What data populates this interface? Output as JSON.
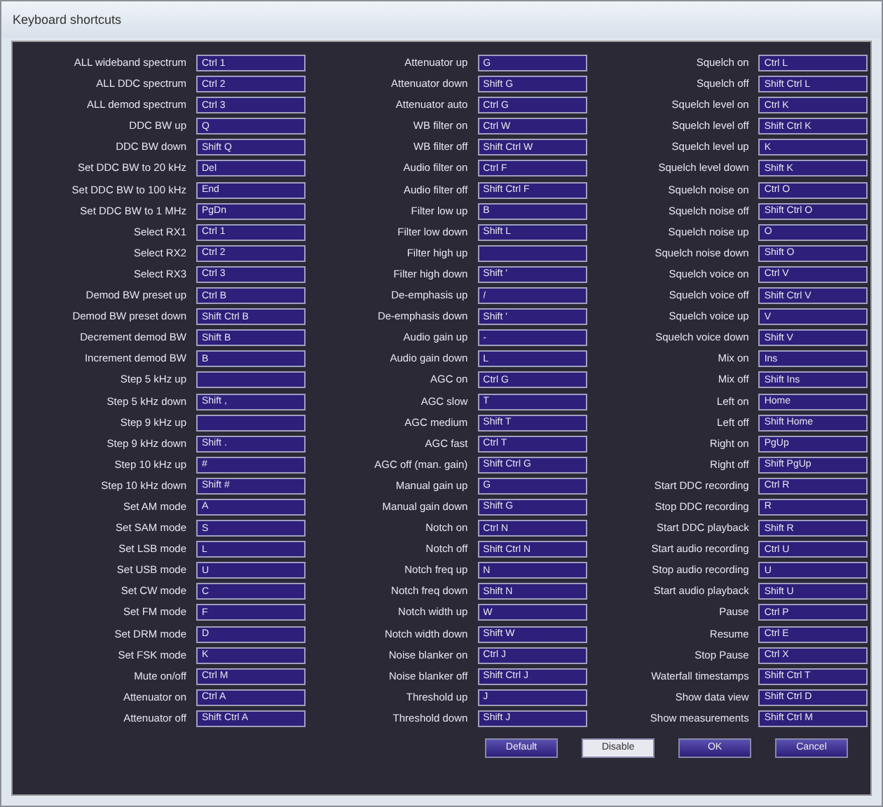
{
  "window": {
    "title": "Keyboard shortcuts"
  },
  "columns": [
    {
      "shortcuts": [
        {
          "label": "ALL wideband spectrum",
          "key": "Ctrl 1"
        },
        {
          "label": "ALL DDC spectrum",
          "key": "Ctrl 2"
        },
        {
          "label": "ALL demod spectrum",
          "key": "Ctrl 3"
        },
        {
          "label": "DDC BW up",
          "key": "Q"
        },
        {
          "label": "DDC BW down",
          "key": "Shift Q"
        },
        {
          "label": "Set DDC BW to 20 kHz",
          "key": "Del"
        },
        {
          "label": "Set DDC BW to 100 kHz",
          "key": "End"
        },
        {
          "label": "Set DDC BW to 1 MHz",
          "key": "PgDn"
        },
        {
          "label": "Select RX1",
          "key": "Ctrl 1"
        },
        {
          "label": "Select RX2",
          "key": "Ctrl 2"
        },
        {
          "label": "Select RX3",
          "key": "Ctrl 3"
        },
        {
          "label": "Demod BW preset up",
          "key": "Ctrl B"
        },
        {
          "label": "Demod BW preset down",
          "key": "Shift Ctrl B"
        },
        {
          "label": "Decrement demod BW",
          "key": "Shift B"
        },
        {
          "label": "Increment demod BW",
          "key": "B"
        },
        {
          "label": "Step 5 kHz up"
        },
        {
          "label": "Step 5 kHz down",
          "key": "Shift ,"
        },
        {
          "label": "Step 9 kHz up"
        },
        {
          "label": "Step 9 kHz down",
          "key": "Shift ."
        },
        {
          "label": "Step 10 kHz up",
          "key": "#"
        },
        {
          "label": "Step 10 kHz down",
          "key": "Shift #"
        },
        {
          "label": "Set AM mode",
          "key": "A"
        },
        {
          "label": "Set SAM mode",
          "key": "S"
        },
        {
          "label": "Set LSB mode",
          "key": "L"
        },
        {
          "label": "Set USB mode",
          "key": "U"
        },
        {
          "label": "Set CW mode",
          "key": "C"
        },
        {
          "label": "Set FM mode",
          "key": "F"
        },
        {
          "label": "Set DRM mode",
          "key": "D"
        },
        {
          "label": "Set FSK mode",
          "key": "K"
        },
        {
          "label": "Mute on/off",
          "key": "Ctrl M"
        },
        {
          "label": "Attenuator on",
          "key": "Ctrl A"
        },
        {
          "label": "Attenuator off",
          "key": "Shift Ctrl A"
        }
      ]
    },
    {
      "shortcuts": [
        {
          "label": "Attenuator up",
          "key": "G"
        },
        {
          "label": "Attenuator down",
          "key": "Shift G"
        },
        {
          "label": "Attenuator auto",
          "key": "Ctrl G"
        },
        {
          "label": "WB filter on",
          "key": "Ctrl W"
        },
        {
          "label": "WB filter off",
          "key": "Shift Ctrl W"
        },
        {
          "label": "Audio filter on",
          "key": "Ctrl F"
        },
        {
          "label": "Audio filter off",
          "key": "Shift Ctrl F"
        },
        {
          "label": "Filter low up",
          "key": "B"
        },
        {
          "label": "Filter low down",
          "key": "Shift L"
        },
        {
          "label": "Filter high up"
        },
        {
          "label": "Filter high down",
          "key": "Shift '"
        },
        {
          "label": "De-emphasis up",
          "key": "/"
        },
        {
          "label": "De-emphasis down",
          "key": "Shift '"
        },
        {
          "label": "Audio gain up",
          "key": "-"
        },
        {
          "label": "Audio gain down",
          "key": "L"
        },
        {
          "label": "AGC on",
          "key": "Ctrl G"
        },
        {
          "label": "AGC slow",
          "key": "T"
        },
        {
          "label": "AGC medium",
          "key": "Shift T"
        },
        {
          "label": "AGC fast",
          "key": "Ctrl T"
        },
        {
          "label": "AGC off (man. gain)",
          "key": "Shift Ctrl G"
        },
        {
          "label": "Manual gain up",
          "key": "G"
        },
        {
          "label": "Manual gain down",
          "key": "Shift G"
        },
        {
          "label": "Notch on",
          "key": "Ctrl N"
        },
        {
          "label": "Notch off",
          "key": "Shift Ctrl N"
        },
        {
          "label": "Notch freq up",
          "key": "N"
        },
        {
          "label": "Notch freq down",
          "key": "Shift N"
        },
        {
          "label": "Notch width up",
          "key": "W"
        },
        {
          "label": "Notch width down",
          "key": "Shift W"
        },
        {
          "label": "Noise blanker on",
          "key": "Ctrl J"
        },
        {
          "label": "Noise blanker off",
          "key": "Shift Ctrl J"
        },
        {
          "label": "Threshold up",
          "key": "J"
        },
        {
          "label": "Threshold down",
          "key": "Shift J"
        }
      ]
    },
    {
      "shortcuts": [
        {
          "label": "Squelch on",
          "key": "Ctrl L"
        },
        {
          "label": "Squelch off",
          "key": "Shift Ctrl L"
        },
        {
          "label": "Squelch level on",
          "key": "Ctrl K"
        },
        {
          "label": "Squelch level off",
          "key": "Shift Ctrl K"
        },
        {
          "label": "Squelch level up",
          "key": "K"
        },
        {
          "label": "Squelch level down",
          "key": "Shift K"
        },
        {
          "label": "Squelch noise on",
          "key": "Ctrl O"
        },
        {
          "label": "Squelch noise off",
          "key": "Shift Ctrl O"
        },
        {
          "label": "Squelch noise up",
          "key": "O"
        },
        {
          "label": "Squelch noise down",
          "key": "Shift O"
        },
        {
          "label": "Squelch voice on",
          "key": "Ctrl V"
        },
        {
          "label": "Squelch voice off",
          "key": "Shift Ctrl V"
        },
        {
          "label": "Squelch voice up",
          "key": "V"
        },
        {
          "label": "Squelch voice down",
          "key": "Shift V"
        },
        {
          "label": "Mix on",
          "key": "Ins"
        },
        {
          "label": "Mix off",
          "key": "Shift Ins"
        },
        {
          "label": "Left on",
          "key": "Home"
        },
        {
          "label": "Left off",
          "key": "Shift Home"
        },
        {
          "label": "Right on",
          "key": "PgUp"
        },
        {
          "label": "Right off",
          "key": "Shift PgUp"
        },
        {
          "label": "Start DDC recording",
          "key": "Ctrl R"
        },
        {
          "label": "Stop DDC recording",
          "key": "R"
        },
        {
          "label": "Start DDC playback",
          "key": "Shift R"
        },
        {
          "label": "Start audio recording",
          "key": "Ctrl U"
        },
        {
          "label": "Stop audio recording",
          "key": "U"
        },
        {
          "label": "Start audio playback",
          "key": "Shift U"
        },
        {
          "label": "Pause",
          "key": "Ctrl P"
        },
        {
          "label": "Resume",
          "key": "Ctrl E"
        },
        {
          "label": "Stop Pause",
          "key": "Ctrl X"
        },
        {
          "label": "Waterfall timestamps",
          "key": "Shift Ctrl T"
        },
        {
          "label": "Show data view",
          "key": "Shift Ctrl D"
        },
        {
          "label": "Show measurements",
          "key": "Shift Ctrl M"
        }
      ]
    }
  ],
  "buttons": [
    {
      "label": "Default",
      "selected": false
    },
    {
      "label": "Disable",
      "selected": true
    },
    {
      "label": "OK",
      "selected": false
    },
    {
      "label": "Cancel",
      "selected": false
    }
  ]
}
